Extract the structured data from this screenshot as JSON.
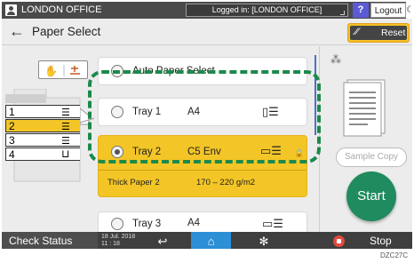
{
  "topbar": {
    "office": "LONDON OFFICE",
    "login_status": "Logged in: [LONDON OFFICE]",
    "help_label": "?",
    "logout_label": "Logout"
  },
  "header": {
    "back_glyph": "←",
    "title": "Paper Select",
    "reset_label": "Reset"
  },
  "machine": {
    "tray_numbers": [
      "1",
      "2",
      "3",
      "4"
    ]
  },
  "trays": {
    "auto": {
      "label": "Auto Paper Select"
    },
    "tray1": {
      "name": "Tray 1",
      "size": "A4"
    },
    "tray2": {
      "name": "Tray 2",
      "size": "C5 Env",
      "paper_type": "Thick Paper 2",
      "weight": "170 – 220 g/m2"
    },
    "tray3": {
      "name": "Tray 3",
      "size": "A4"
    }
  },
  "right_panel": {
    "sample_copy_label": "Sample Copy",
    "start_label": "Start"
  },
  "bottombar": {
    "check_status_label": "Check Status",
    "date_line1": "18 Jul. 2018",
    "date_line2": "11 : 18",
    "stop_label": "Stop"
  },
  "caption": "DZC27C",
  "colors": {
    "selected_tray": "#f3c526",
    "dashed_highlight": "#1b8a4a",
    "start_button": "#1f8b5e",
    "home_button": "#2d8fd6",
    "help_button": "#5b5bd6"
  }
}
